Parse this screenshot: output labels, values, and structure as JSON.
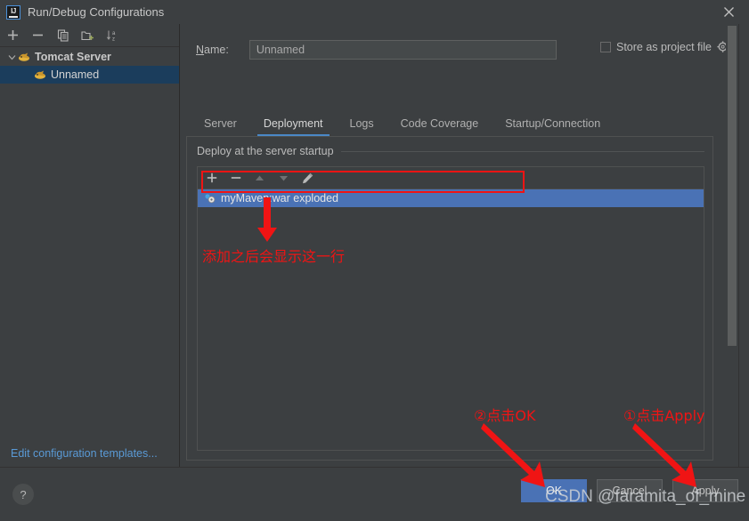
{
  "window": {
    "title": "Run/Debug Configurations",
    "logo_icon": "intellij-idea-logo-icon",
    "close_icon": "close-icon"
  },
  "sidebar": {
    "toolbar": [
      {
        "name": "add-configuration",
        "icon": "plus-icon",
        "glyph": "+"
      },
      {
        "name": "remove-configuration",
        "icon": "minus-icon",
        "glyph": "−"
      },
      {
        "name": "copy-configuration",
        "icon": "copy-icon",
        "glyph": "⧉"
      },
      {
        "name": "save-configuration",
        "icon": "folder-add-icon",
        "glyph": "Ὄ1"
      },
      {
        "name": "sort-configurations",
        "icon": "sort-alpha-icon",
        "glyph": "↓"
      }
    ],
    "tree": [
      {
        "label": "Tomcat Server",
        "icon": "tomcat-icon",
        "expanded": true,
        "selected": false
      },
      {
        "label": "Unnamed",
        "icon": "tomcat-icon",
        "expanded": false,
        "selected": true
      }
    ],
    "edit_templates_link": "Edit configuration templates..."
  },
  "form": {
    "name_label": "Name:",
    "name_label_mnemonic": "N",
    "name_value": "Unnamed",
    "name_placeholder": "Unnamed",
    "store_as_project_file_label": "Store as project file",
    "store_as_project_file_checked": false,
    "store_gear_icon": "gear-icon"
  },
  "tabs": [
    {
      "label": "Server",
      "active": false
    },
    {
      "label": "Deployment",
      "active": true
    },
    {
      "label": "Logs",
      "active": false
    },
    {
      "label": "Code Coverage",
      "active": false
    },
    {
      "label": "Startup/Connection",
      "active": false
    }
  ],
  "deployment_panel": {
    "group_title": "Deploy at the server startup",
    "toolbar": [
      {
        "name": "add-artifact",
        "icon": "plus-icon",
        "glyph": "+",
        "enabled": true
      },
      {
        "name": "remove-artifact",
        "icon": "minus-icon",
        "glyph": "−",
        "enabled": true
      },
      {
        "name": "move-up",
        "icon": "triangle-up-icon",
        "glyph": "▲",
        "enabled": false
      },
      {
        "name": "move-down",
        "icon": "triangle-down-icon",
        "glyph": "▼",
        "enabled": false
      },
      {
        "name": "edit-artifact",
        "icon": "pencil-icon",
        "glyph": "✎",
        "enabled": true
      }
    ],
    "rows": [
      {
        "label": "myMaven:war exploded",
        "icon": "artifact-icon",
        "selected": true
      }
    ]
  },
  "footer": {
    "help_label": "?",
    "help_icon": "question-mark-icon",
    "buttons": [
      {
        "id": "btn-ok",
        "label": "OK",
        "primary": true
      },
      {
        "id": "btn-cancel",
        "label": "Cancel",
        "primary": false
      },
      {
        "id": "btn-apply",
        "label": "Apply",
        "primary": false
      }
    ]
  },
  "annotations": {
    "color": "#f01414",
    "row_note": "添加之后会显示这一行",
    "ok_note": "②点击OK",
    "apply_note": "①点击Apply"
  },
  "watermark": "CSDN @faramita_of_mine"
}
